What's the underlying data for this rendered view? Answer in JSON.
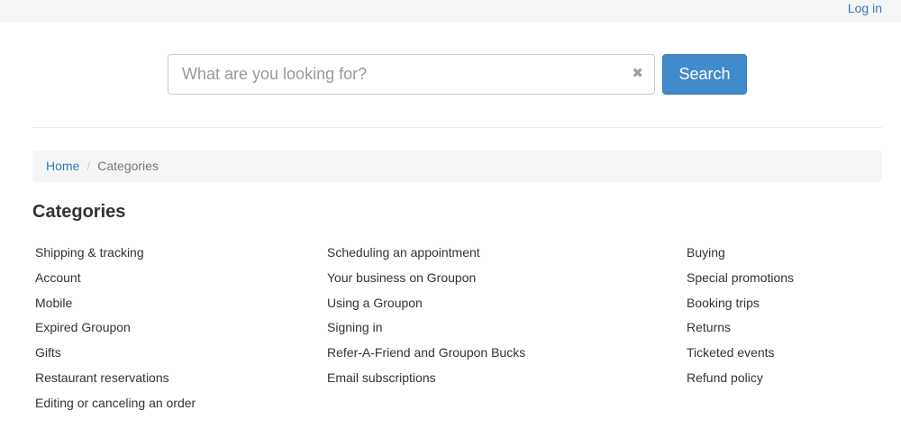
{
  "header": {
    "login_label": "Log in"
  },
  "search": {
    "placeholder": "What are you looking for?",
    "button_label": "Search",
    "clear_symbol": "✖"
  },
  "breadcrumb": {
    "home": "Home",
    "separator": "/",
    "current": "Categories"
  },
  "page_title": "Categories",
  "categories": {
    "col1": [
      "Shipping & tracking",
      "Account",
      "Mobile",
      "Expired Groupon",
      "Gifts",
      "Restaurant reservations",
      "Editing or canceling an order"
    ],
    "col2": [
      "Scheduling an appointment",
      "Your business on Groupon",
      "Using a Groupon",
      "Signing in",
      "Refer-A-Friend and Groupon Bucks",
      "Email subscriptions"
    ],
    "col3": [
      "Buying",
      "Special promotions",
      "Booking trips",
      "Returns",
      "Ticketed events",
      "Refund policy"
    ]
  },
  "colors": {
    "link": "#337ab7",
    "button": "#428bca",
    "breadcrumb_bg": "#f5f5f5"
  }
}
